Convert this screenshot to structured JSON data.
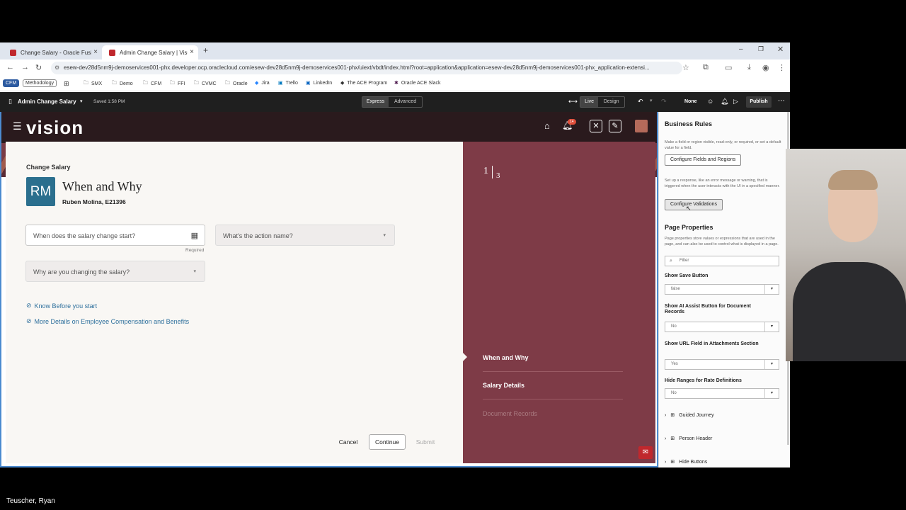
{
  "browser": {
    "tabs": [
      {
        "label": "Change Salary - Oracle Fusion",
        "active": false
      },
      {
        "label": "Admin Change Salary | Visual B",
        "active": true
      }
    ],
    "url": "esew-dev28d5nm9j-demoservices001-phx.developer.ocp.oraclecloud.com/esew-dev28d5nm9j-demoservices001-phx/uiext/vbdt/index.html?root=application&application=esew-dev28d5nm9j-demoservices001-phx_application-extensi...",
    "bookmarks": [
      "CFM",
      "Methodology",
      "SMX",
      "Demo",
      "CFM",
      "FFI",
      "CVMC",
      "Oracle",
      "Jira",
      "Trello",
      "LinkedIn",
      "The ACE Program",
      "Oracle ACE Slack"
    ]
  },
  "vb_toolbar": {
    "page_name": "Admin Change Salary",
    "saved": "Saved 1:58 PM",
    "modes": [
      "Express",
      "Advanced"
    ],
    "view_modes": [
      "Live",
      "Design"
    ],
    "none_label": "None",
    "publish": "Publish"
  },
  "app": {
    "brand": "vision",
    "notification_count": "14",
    "card": {
      "overline": "Change Salary",
      "avatar_initials": "RM",
      "title": "When and Why",
      "subtitle": "Ruben Molina, E21396",
      "start_field_placeholder": "When does the salary change start?",
      "required": "Required",
      "action_field_placeholder": "What's the action name?",
      "reason_field_placeholder": "Why are you changing the salary?",
      "links": [
        "Know Before you start",
        "More Details on Employee Compensation and Benefits"
      ],
      "buttons": {
        "cancel": "Cancel",
        "continue": "Continue",
        "submit": "Submit"
      }
    },
    "progress": {
      "current": "1",
      "total": "3"
    },
    "steps": [
      "When and Why",
      "Salary Details",
      "Document Records"
    ]
  },
  "side_panel": {
    "business_rules": {
      "title": "Business Rules",
      "desc1": "Make a field or region visible, read-only, or required, or set a default value for a field.",
      "btn1": "Configure Fields and Regions",
      "desc2": "Set up a response, like an error message or warning, that is triggered when the user interacts with the UI in a specified manner.",
      "btn2": "Configure Validations"
    },
    "page_properties": {
      "title": "Page Properties",
      "desc": "Page properties store values or expressions that are used in the page, and can also be used to control what is displayed in a page.",
      "filter_placeholder": "Filter",
      "props": [
        {
          "label": "Show Save Button",
          "value": "false"
        },
        {
          "label": "Show AI Assist Button for Document Records",
          "value": "No"
        },
        {
          "label": "Show URL Field in Attachments Section",
          "value": "Yes"
        },
        {
          "label": "Hide Ranges for Rate Definitions",
          "value": "No"
        }
      ],
      "tree": [
        "Guided Journey",
        "Person Header",
        "Hide Buttons"
      ]
    }
  },
  "caption": "Teuscher, Ryan"
}
